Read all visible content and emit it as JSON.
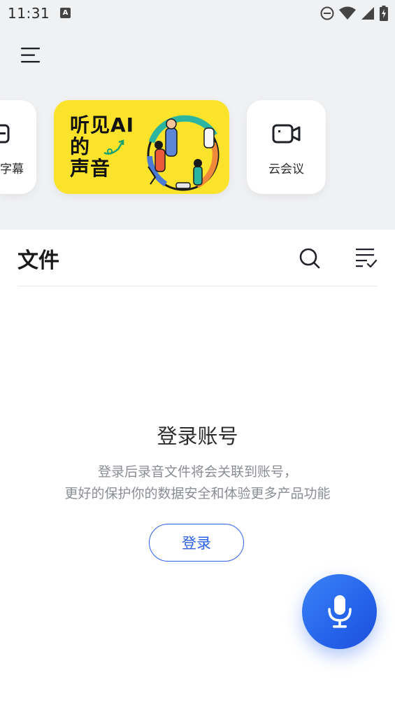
{
  "status_bar": {
    "time": "11:31",
    "notification_badge": "A",
    "icons": [
      "do-not-disturb-icon",
      "wifi-icon",
      "cellular-signal-icon",
      "battery-charging-icon"
    ]
  },
  "header": {
    "menu_icon": "menu-icon"
  },
  "cards": {
    "subtitle": {
      "label": "字幕",
      "icon": "subtitle-icon"
    },
    "banner": {
      "lines": [
        "听见AI",
        "的",
        "声音"
      ]
    },
    "meeting": {
      "label": "云会议",
      "icon": "video-camera-icon"
    }
  },
  "files": {
    "title": "文件",
    "search_icon": "search-icon",
    "sort_icon": "filter-list-icon"
  },
  "empty_state": {
    "title": "登录账号",
    "description_line1": "登录后录音文件将会关联到账号，",
    "description_line2": "更好的保护你的数据安全和体验更多产品功能",
    "button_label": "登录"
  },
  "fab": {
    "icon": "microphone-icon"
  },
  "colors": {
    "accent": "#2d62e8",
    "banner_bg": "#fbe32b",
    "top_bg": "#f0f1f3"
  }
}
